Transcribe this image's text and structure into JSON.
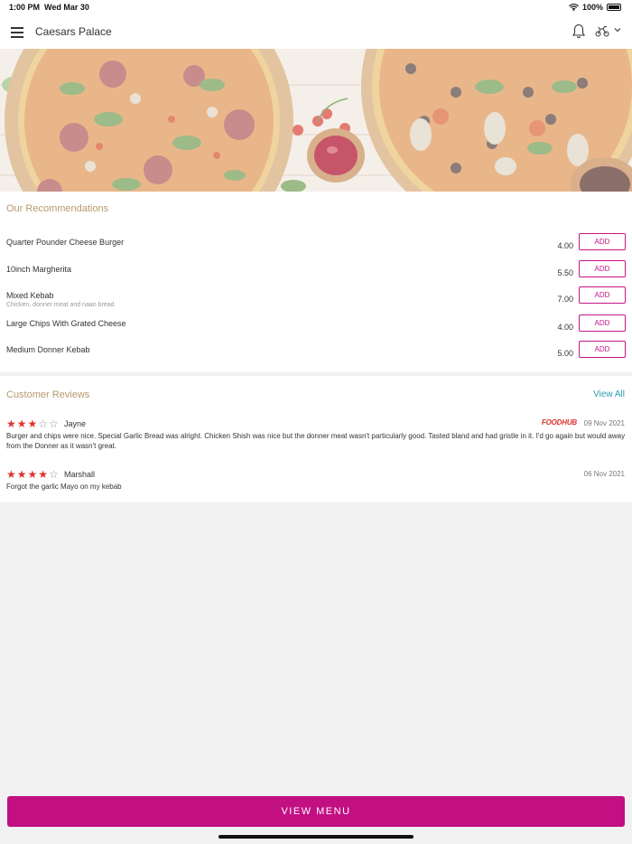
{
  "status": {
    "time": "1:00 PM",
    "date": "Wed Mar 30",
    "battery": "100%"
  },
  "header": {
    "title": "Caesars Palace",
    "menu_icon": "hamburger-icon",
    "bell_icon": "bell-icon",
    "delivery_icon": "scooter-icon",
    "dropdown_icon": "chevron-down-icon"
  },
  "recommendations": {
    "title": "Our Recommendations",
    "add_label": "ADD",
    "items": [
      {
        "name": "Quarter Pounder Cheese Burger",
        "desc": "",
        "price": "4.00"
      },
      {
        "name": "10inch Margherita",
        "desc": "",
        "price": "5.50"
      },
      {
        "name": "Mixed Kebab",
        "desc": "Chicken, donner meat and naan bread",
        "price": "7.00"
      },
      {
        "name": "Large Chips With Grated Cheese",
        "desc": "",
        "price": "4.00"
      },
      {
        "name": "Medium Donner Kebab",
        "desc": "",
        "price": "5.00"
      }
    ]
  },
  "reviews": {
    "title": "Customer Reviews",
    "view_all": "View All",
    "items": [
      {
        "name": "Jayne",
        "rating": 3,
        "max": 5,
        "source": "FOODHUB",
        "date": "09 Nov 2021",
        "text": "Burger and chips were nice. Special Garlic Bread was alright. Chicken Shish was nice but the donner meat wasn't particularly good. Tasted bland and had gristle in it. I'd go again but would away from the Donner as it wasn't great."
      },
      {
        "name": "Marshall",
        "rating": 4,
        "max": 5,
        "source": "",
        "date": "06 Nov 2021",
        "text": "Forgot the garlic Mayo on my kebab"
      }
    ]
  },
  "footer": {
    "view_menu": "VIEW MENU"
  },
  "colors": {
    "accent": "#c20f82",
    "section_title": "#b8996b",
    "link": "#2b9bb4",
    "star": "#e0322e"
  }
}
